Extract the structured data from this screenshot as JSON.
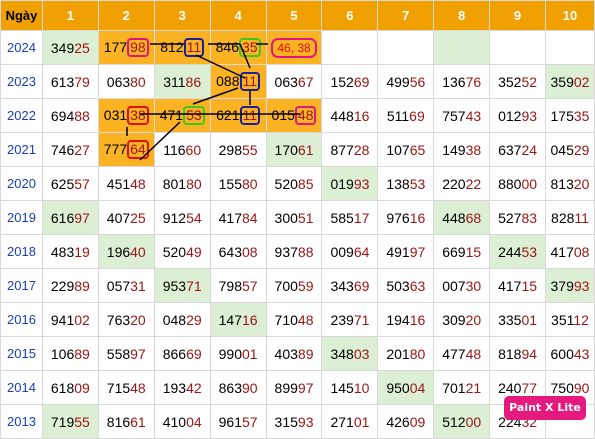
{
  "header": [
    "Ngày",
    "1",
    "2",
    "3",
    "4",
    "5",
    "6",
    "7",
    "8",
    "9",
    "10"
  ],
  "rows": [
    {
      "year": "2024",
      "cells": [
        {
          "head": "349",
          "tail": "25",
          "bg": "g"
        },
        {
          "head": "177",
          "tail": "98",
          "bg": "o",
          "mark": "pink"
        },
        {
          "head": "812",
          "tail": "11",
          "bg": "o",
          "mark": "navy"
        },
        {
          "head": "846",
          "tail": "35",
          "bg": "o",
          "mark": "green"
        },
        {
          "pair": "46, 38",
          "bg": "o"
        },
        {
          "head": "",
          "tail": ""
        },
        {
          "head": "",
          "tail": ""
        },
        {
          "head": "",
          "tail": "",
          "bg": "g"
        },
        {
          "head": "",
          "tail": ""
        },
        {
          "head": "",
          "tail": ""
        }
      ]
    },
    {
      "year": "2023",
      "cells": [
        {
          "head": "613",
          "tail": "79"
        },
        {
          "head": "063",
          "tail": "80"
        },
        {
          "head": "311",
          "tail": "86",
          "bg": "g"
        },
        {
          "head": "088",
          "tail": "11",
          "bg": "o",
          "mark": "navy"
        },
        {
          "head": "063",
          "tail": "67"
        },
        {
          "head": "152",
          "tail": "69"
        },
        {
          "head": "499",
          "tail": "56"
        },
        {
          "head": "136",
          "tail": "76"
        },
        {
          "head": "352",
          "tail": "52"
        },
        {
          "head": "359",
          "tail": "02",
          "bg": "g"
        }
      ]
    },
    {
      "year": "2022",
      "cells": [
        {
          "head": "694",
          "tail": "88"
        },
        {
          "head": "031",
          "tail": "38",
          "bg": "o",
          "mark": "red"
        },
        {
          "head": "471",
          "tail": "53",
          "bg": "o",
          "mark": "green"
        },
        {
          "head": "621",
          "tail": "11",
          "bg": "o",
          "mark": "navy"
        },
        {
          "head": "015",
          "tail": "48",
          "bg": "o",
          "mark": "pink"
        },
        {
          "head": "448",
          "tail": "16"
        },
        {
          "head": "511",
          "tail": "69"
        },
        {
          "head": "757",
          "tail": "43"
        },
        {
          "head": "012",
          "tail": "93"
        },
        {
          "head": "175",
          "tail": "35"
        }
      ]
    },
    {
      "year": "2021",
      "cells": [
        {
          "head": "746",
          "tail": "27"
        },
        {
          "head": "777",
          "tail": "64",
          "bg": "o",
          "mark": "red"
        },
        {
          "head": "116",
          "tail": "60"
        },
        {
          "head": "298",
          "tail": "55"
        },
        {
          "head": "170",
          "tail": "61",
          "bg": "g"
        },
        {
          "head": "877",
          "tail": "28"
        },
        {
          "head": "107",
          "tail": "65"
        },
        {
          "head": "149",
          "tail": "38"
        },
        {
          "head": "637",
          "tail": "24"
        },
        {
          "head": "045",
          "tail": "29"
        }
      ]
    },
    {
      "year": "2020",
      "cells": [
        {
          "head": "625",
          "tail": "57"
        },
        {
          "head": "451",
          "tail": "48"
        },
        {
          "head": "801",
          "tail": "80"
        },
        {
          "head": "155",
          "tail": "80"
        },
        {
          "head": "520",
          "tail": "85"
        },
        {
          "head": "019",
          "tail": "93",
          "bg": "g"
        },
        {
          "head": "138",
          "tail": "53"
        },
        {
          "head": "220",
          "tail": "22"
        },
        {
          "head": "880",
          "tail": "00"
        },
        {
          "head": "813",
          "tail": "20"
        }
      ]
    },
    {
      "year": "2019",
      "cells": [
        {
          "head": "616",
          "tail": "97",
          "bg": "g"
        },
        {
          "head": "407",
          "tail": "25"
        },
        {
          "head": "912",
          "tail": "54"
        },
        {
          "head": "417",
          "tail": "84"
        },
        {
          "head": "300",
          "tail": "51"
        },
        {
          "head": "585",
          "tail": "17"
        },
        {
          "head": "976",
          "tail": "16"
        },
        {
          "head": "448",
          "tail": "68",
          "bg": "g"
        },
        {
          "head": "527",
          "tail": "83"
        },
        {
          "head": "828",
          "tail": "11"
        }
      ]
    },
    {
      "year": "2018",
      "cells": [
        {
          "head": "483",
          "tail": "19"
        },
        {
          "head": "196",
          "tail": "40",
          "bg": "g"
        },
        {
          "head": "520",
          "tail": "49"
        },
        {
          "head": "643",
          "tail": "08"
        },
        {
          "head": "937",
          "tail": "88"
        },
        {
          "head": "009",
          "tail": "64"
        },
        {
          "head": "491",
          "tail": "97"
        },
        {
          "head": "669",
          "tail": "15"
        },
        {
          "head": "244",
          "tail": "53",
          "bg": "g"
        },
        {
          "head": "417",
          "tail": "08"
        }
      ]
    },
    {
      "year": "2017",
      "cells": [
        {
          "head": "229",
          "tail": "89"
        },
        {
          "head": "057",
          "tail": "31"
        },
        {
          "head": "953",
          "tail": "71",
          "bg": "g"
        },
        {
          "head": "798",
          "tail": "57"
        },
        {
          "head": "700",
          "tail": "59"
        },
        {
          "head": "343",
          "tail": "69"
        },
        {
          "head": "503",
          "tail": "63"
        },
        {
          "head": "007",
          "tail": "30"
        },
        {
          "head": "417",
          "tail": "15"
        },
        {
          "head": "379",
          "tail": "93",
          "bg": "g"
        }
      ]
    },
    {
      "year": "2016",
      "cells": [
        {
          "head": "941",
          "tail": "02"
        },
        {
          "head": "763",
          "tail": "20"
        },
        {
          "head": "048",
          "tail": "29"
        },
        {
          "head": "147",
          "tail": "16",
          "bg": "g"
        },
        {
          "head": "710",
          "tail": "48"
        },
        {
          "head": "239",
          "tail": "71"
        },
        {
          "head": "194",
          "tail": "16"
        },
        {
          "head": "309",
          "tail": "20"
        },
        {
          "head": "335",
          "tail": "01"
        },
        {
          "head": "351",
          "tail": "12"
        }
      ]
    },
    {
      "year": "2015",
      "cells": [
        {
          "head": "106",
          "tail": "89"
        },
        {
          "head": "558",
          "tail": "97"
        },
        {
          "head": "866",
          "tail": "69"
        },
        {
          "head": "990",
          "tail": "01"
        },
        {
          "head": "403",
          "tail": "89"
        },
        {
          "head": "348",
          "tail": "03",
          "bg": "g"
        },
        {
          "head": "201",
          "tail": "80"
        },
        {
          "head": "477",
          "tail": "48"
        },
        {
          "head": "818",
          "tail": "94"
        },
        {
          "head": "600",
          "tail": "43"
        }
      ]
    },
    {
      "year": "2014",
      "cells": [
        {
          "head": "618",
          "tail": "09"
        },
        {
          "head": "715",
          "tail": "48"
        },
        {
          "head": "193",
          "tail": "42"
        },
        {
          "head": "863",
          "tail": "90"
        },
        {
          "head": "899",
          "tail": "97"
        },
        {
          "head": "145",
          "tail": "10"
        },
        {
          "head": "950",
          "tail": "04",
          "bg": "g"
        },
        {
          "head": "701",
          "tail": "21"
        },
        {
          "head": "240",
          "tail": "77"
        },
        {
          "head": "750",
          "tail": "90"
        }
      ]
    },
    {
      "year": "2013",
      "cells": [
        {
          "head": "719",
          "tail": "55",
          "bg": "g"
        },
        {
          "head": "816",
          "tail": "61"
        },
        {
          "head": "410",
          "tail": "04"
        },
        {
          "head": "961",
          "tail": "57"
        },
        {
          "head": "315",
          "tail": "93"
        },
        {
          "head": "271",
          "tail": "01"
        },
        {
          "head": "426",
          "tail": "09"
        },
        {
          "head": "512",
          "tail": "00",
          "bg": "g"
        },
        {
          "head": "224",
          "tail": "32"
        },
        {
          "head": "",
          "tail": ""
        }
      ]
    }
  ],
  "badge": "Paint X Lite",
  "colors": {
    "header": "#f0a000",
    "highlight": "#fbb324",
    "green_cell": "#dcefd4",
    "tail_digits": "#9a1515",
    "year": "#1a3fb4"
  }
}
